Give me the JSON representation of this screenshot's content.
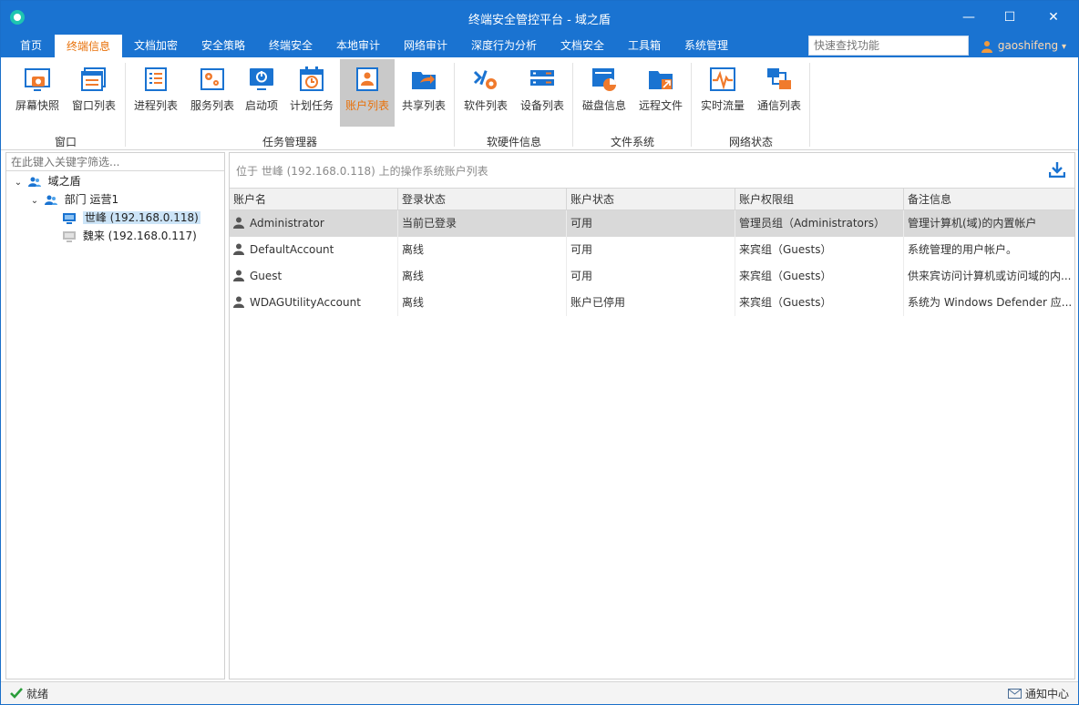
{
  "window": {
    "title": "终端安全管控平台 - 域之盾",
    "minimize_glyph": "—",
    "maximize_glyph": "☐",
    "close_glyph": "✕"
  },
  "menu": {
    "tabs": [
      "首页",
      "终端信息",
      "文档加密",
      "安全策略",
      "终端安全",
      "本地审计",
      "网络审计",
      "深度行为分析",
      "文档安全",
      "工具箱",
      "系统管理"
    ],
    "active_tab": "终端信息",
    "search_placeholder": "快速查找功能",
    "user": "gaoshifeng",
    "user_caret": "▾"
  },
  "ribbon": {
    "groups": [
      {
        "label": "窗口",
        "buttons": [
          "屏幕快照",
          "窗口列表"
        ]
      },
      {
        "label": "任务管理器",
        "buttons": [
          "进程列表",
          "服务列表",
          "启动项",
          "计划任务",
          "账户列表",
          "共享列表"
        ]
      },
      {
        "label": "软硬件信息",
        "buttons": [
          "软件列表",
          "设备列表"
        ]
      },
      {
        "label": "文件系统",
        "buttons": [
          "磁盘信息",
          "远程文件"
        ]
      },
      {
        "label": "网络状态",
        "buttons": [
          "实时流量",
          "通信列表"
        ]
      }
    ],
    "active_button": "账户列表",
    "icons": [
      "screenshot-icon",
      "window-list-icon",
      "process-list-icon",
      "service-list-icon",
      "startup-icon",
      "scheduled-task-icon",
      "account-list-icon",
      "share-list-icon",
      "software-list-icon",
      "device-list-icon",
      "disk-info-icon",
      "remote-file-icon",
      "realtime-traffic-icon",
      "connection-list-icon"
    ]
  },
  "tree": {
    "filter_placeholder": "在此键入关键字筛选...",
    "root": "域之盾",
    "department": "部门 运营1",
    "computers": [
      "世峰 (192.168.0.118)",
      "魏来 (192.168.0.117)"
    ],
    "selected": "世峰 (192.168.0.118)",
    "expanded_glyph": "⌄"
  },
  "content": {
    "breadcrumb": "位于 世峰 (192.168.0.118) 上的操作系统账户列表",
    "columns": [
      "账户名",
      "登录状态",
      "账户状态",
      "账户权限组",
      "备注信息"
    ],
    "rows": [
      [
        "Administrator",
        "当前已登录",
        "可用",
        "管理员组（Administrators）",
        "管理计算机(域)的内置帐户"
      ],
      [
        "DefaultAccount",
        "离线",
        "可用",
        "来宾组（Guests）",
        "系统管理的用户帐户。"
      ],
      [
        "Guest",
        "离线",
        "可用",
        "来宾组（Guests）",
        "供来宾访问计算机或访问域的内..."
      ],
      [
        "WDAGUtilityAccount",
        "离线",
        "账户已停用",
        "来宾组（Guests）",
        "系统为 Windows Defender 应..."
      ]
    ]
  },
  "status": {
    "left": "就绪",
    "right": "通知中心"
  },
  "colors": {
    "title_blue": "#1a73d1",
    "accent_orange": "#e8710a",
    "selected_row": "#d9d9d9",
    "tree_selected": "#cce4f7"
  }
}
